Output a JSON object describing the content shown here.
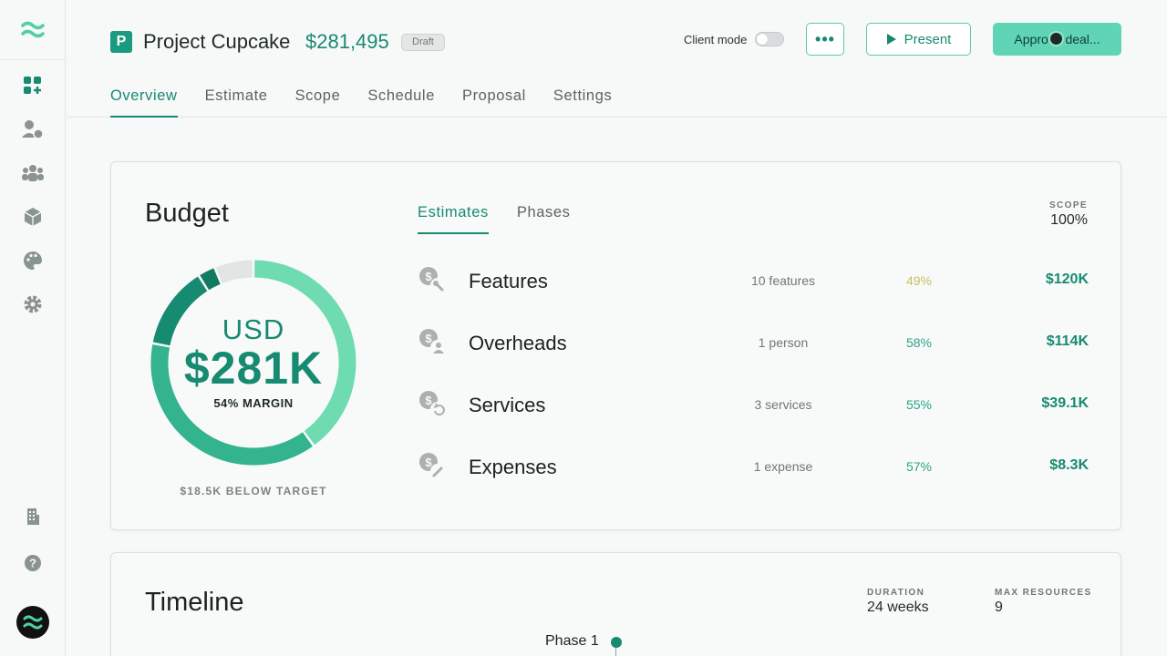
{
  "project": {
    "badge": "P",
    "name": "Project Cupcake",
    "price": "$281,495",
    "status": "Draft"
  },
  "header": {
    "client_mode_label": "Client mode",
    "more_label": "•••",
    "present_label": "Present",
    "approve_label": "Approve deal..."
  },
  "nav": {
    "tabs": [
      "Overview",
      "Estimate",
      "Scope",
      "Schedule",
      "Proposal",
      "Settings"
    ],
    "active": "Overview"
  },
  "sidebar": {
    "icons": [
      "wave-logo-icon",
      "dashboard-icon",
      "client-billing-icon",
      "team-icon",
      "box-icon",
      "palette-icon",
      "settings-gear-icon",
      "building-icon",
      "help-icon",
      "user-avatar"
    ]
  },
  "budget": {
    "title": "Budget",
    "currency": "USD",
    "total": "$281K",
    "margin": "54% MARGIN",
    "below_target": "$18.5K BELOW TARGET",
    "tabs": [
      "Estimates",
      "Phases"
    ],
    "active_tab": "Estimates",
    "scope_label": "SCOPE",
    "scope_value": "100%",
    "segments": [
      {
        "name": "Features",
        "value": 120,
        "color": "#6fdbb0"
      },
      {
        "name": "Overheads",
        "value": 114,
        "color": "#33b48e"
      },
      {
        "name": "Services",
        "value": 39.1,
        "color": "#178a72"
      },
      {
        "name": "Expenses",
        "value": 8.3,
        "color": "#137a63"
      },
      {
        "name": "Remaining",
        "value": 18.5,
        "color": "#e2e5e5"
      }
    ],
    "rows": [
      {
        "name": "Features",
        "count": "10 features",
        "pct": "49%",
        "pct_color": "#c9c05e",
        "amount": "$120K"
      },
      {
        "name": "Overheads",
        "count": "1 person",
        "pct": "58%",
        "pct_color": "#2ba384",
        "amount": "$114K"
      },
      {
        "name": "Services",
        "count": "3 services",
        "pct": "55%",
        "pct_color": "#2ba384",
        "amount": "$39.1K"
      },
      {
        "name": "Expenses",
        "count": "1 expense",
        "pct": "57%",
        "pct_color": "#2ba384",
        "amount": "$8.3K"
      }
    ]
  },
  "timeline": {
    "title": "Timeline",
    "duration_label": "DURATION",
    "duration_value": "24 weeks",
    "max_resources_label": "MAX RESOURCES",
    "max_resources_value": "9",
    "phase_label": "Phase 1"
  },
  "colors": {
    "accent": "#178a72",
    "accent_light": "#5fd5b5"
  }
}
